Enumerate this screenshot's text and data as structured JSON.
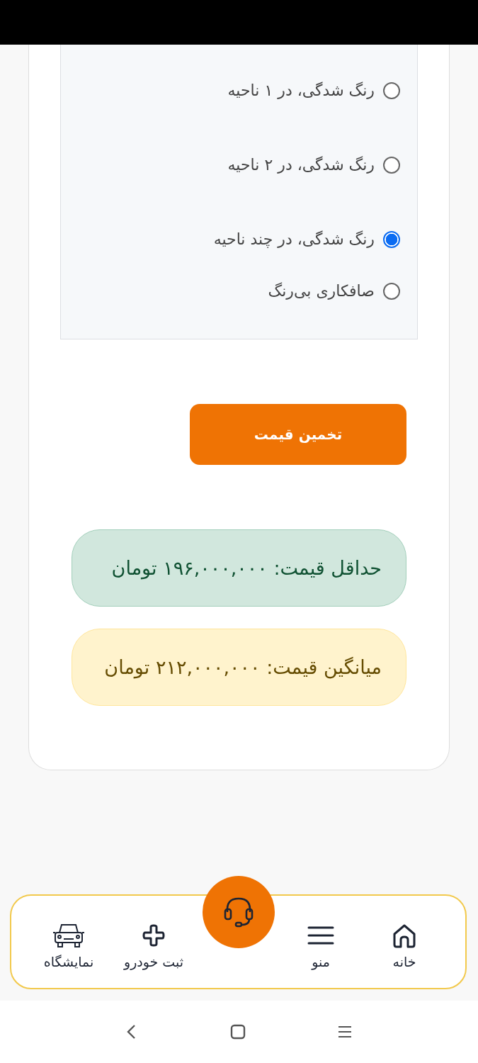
{
  "options": [
    {
      "label": "رنگ شدگی، در ۱ ناحیه",
      "selected": false
    },
    {
      "label": "رنگ شدگی، در ۲ ناحیه",
      "selected": false
    },
    {
      "label": "رنگ شدگی، در چند ناحیه",
      "selected": true
    },
    {
      "label": "صافکاری بی‌رنگ",
      "selected": false
    }
  ],
  "estimate_button": "تخمین قیمت",
  "results": [
    {
      "kind": "min",
      "text": "حداقل قیمت: ۱۹۶,۰۰۰,۰۰۰ تومان"
    },
    {
      "kind": "avg",
      "text": "میانگین قیمت: ۲۱۲,۰۰۰,۰۰۰ تومان"
    }
  ],
  "bottom_nav": [
    {
      "label": "خانه"
    },
    {
      "label": "منو"
    },
    {
      "label": "ثبت خودرو"
    },
    {
      "label": "نمایشگاه"
    }
  ]
}
